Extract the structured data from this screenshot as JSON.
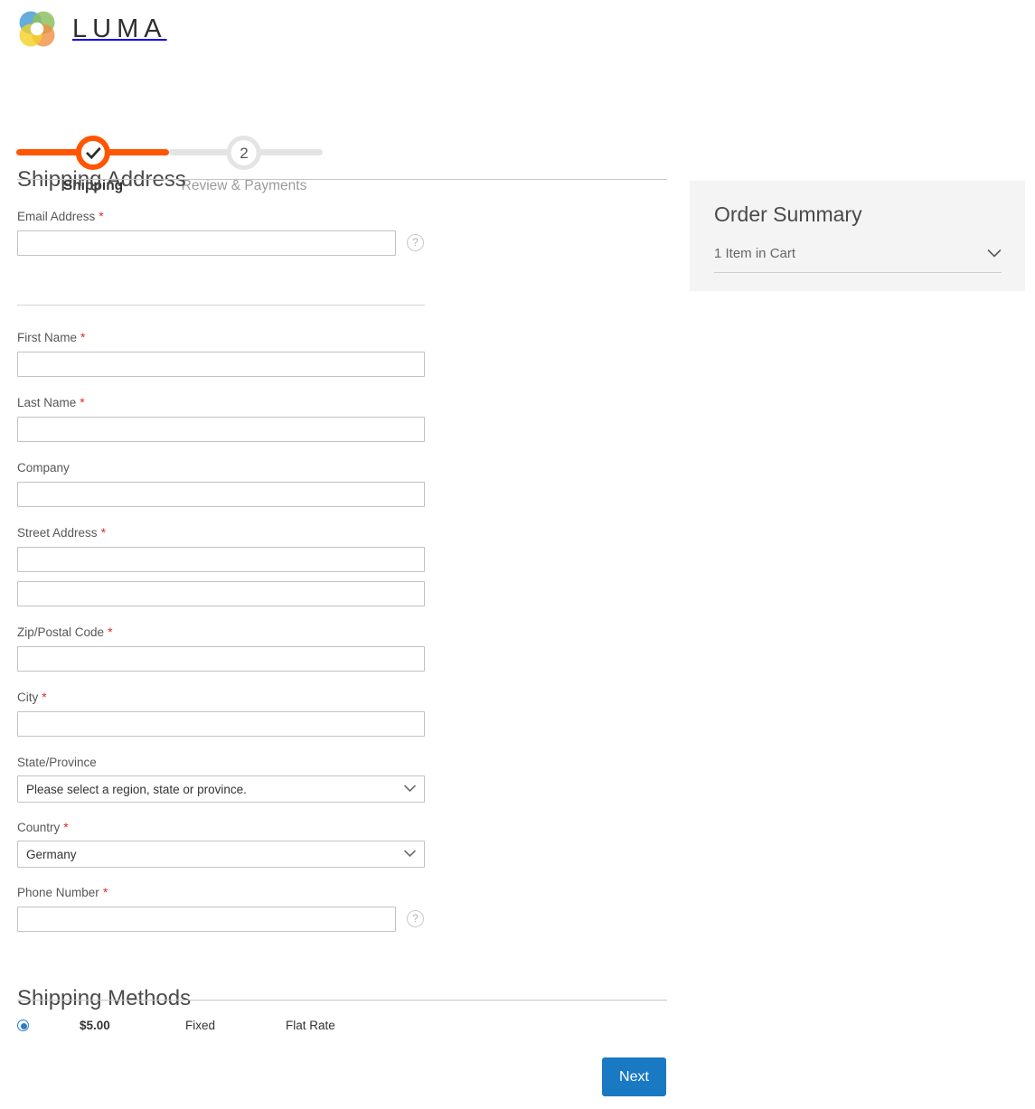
{
  "brand": {
    "name": "LUMA",
    "logo_icon": "luma-rings-logo",
    "colors": {
      "ring_blue": "#4a9fd8",
      "ring_green": "#7ab648",
      "ring_orange": "#ef7d22",
      "ring_yellow": "#f2c800"
    }
  },
  "progress": {
    "steps": [
      {
        "label": "Shipping",
        "marker": "check",
        "state": "complete"
      },
      {
        "label": "Review & Payments",
        "marker": "2",
        "state": "upcoming"
      }
    ],
    "active_color": "#ff5501",
    "inactive_color": "#e4e4e4"
  },
  "shipping_address": {
    "title": "Shipping Address",
    "fields": {
      "email": {
        "label": "Email Address",
        "required": "*",
        "value": "",
        "placeholder": "",
        "help_icon": "question-mark-icon"
      },
      "first_name": {
        "label": "First Name",
        "required": "*",
        "value": "",
        "placeholder": ""
      },
      "last_name": {
        "label": "Last Name",
        "required": "*",
        "value": "",
        "placeholder": ""
      },
      "company": {
        "label": "Company",
        "required": "",
        "value": "",
        "placeholder": ""
      },
      "street": {
        "label": "Street Address",
        "required": "*",
        "value_line1": "",
        "value_line2": "",
        "placeholder": ""
      },
      "zip": {
        "label": "Zip/Postal Code",
        "required": "*",
        "value": "",
        "placeholder": ""
      },
      "city": {
        "label": "City",
        "required": "*",
        "value": "",
        "placeholder": ""
      },
      "state": {
        "label": "State/Province",
        "required": "",
        "selected": "Please select a region, state or province.",
        "options": [
          "Please select a region, state or province."
        ]
      },
      "country": {
        "label": "Country",
        "required": "*",
        "selected": "Germany",
        "options": [
          "Germany"
        ]
      },
      "phone": {
        "label": "Phone Number",
        "required": "*",
        "value": "",
        "placeholder": "",
        "help_icon": "question-mark-icon"
      }
    }
  },
  "shipping_methods": {
    "title": "Shipping Methods",
    "rows": [
      {
        "selected": true,
        "price": "$5.00",
        "method": "Fixed",
        "carrier": "Flat Rate"
      }
    ]
  },
  "order_summary": {
    "title": "Order Summary",
    "cart_toggle_label": "1 Item in Cart",
    "chevron_icon": "chevron-down-icon",
    "panel_color": "#f4f4f4"
  },
  "actions": {
    "next_label": "Next",
    "next_color": "#1979c3"
  }
}
